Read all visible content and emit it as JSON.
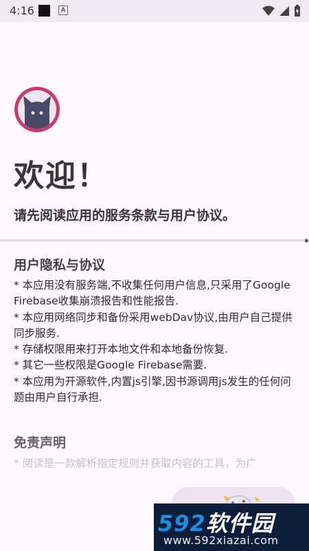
{
  "status_bar": {
    "time": "4:16",
    "icons": [
      "black-square-icon",
      "a-icon",
      "wifi-icon",
      "signal-icon",
      "battery-icon"
    ]
  },
  "welcome": {
    "title": "欢迎！",
    "subtitle": "请先阅读应用的服务条款与用户协议。"
  },
  "privacy": {
    "title": "用户隐私与协议",
    "lines": [
      "* 本应用没有服务端,不收集任何用户信息,只采用了Google Firebase收集崩溃报告和性能报告.",
      "* 本应用网络同步和备份采用webDav协议,由用户自己提供同步服务.",
      "* 存储权限用来打开本地文件和本地备份恢复.",
      "* 其它一些权限是Google Firebase需要.",
      "* 本应用为开源软件,内置js引擎,因书源调用js发生的任何问题由用户自行承担."
    ]
  },
  "disclaimer": {
    "title": "免责声明",
    "text": "* 阅读是一款解析指定规则并获取内容的工具，为广"
  },
  "watermark": {
    "brand_num": "592",
    "brand_text": "软件园",
    "url": "www.592xiazai.com"
  },
  "colors": {
    "accent": "#c93a6e",
    "background": "#fdf8fd",
    "watermark_bg": "#0d1e3a",
    "watermark_blue": "#1e8fe0"
  }
}
